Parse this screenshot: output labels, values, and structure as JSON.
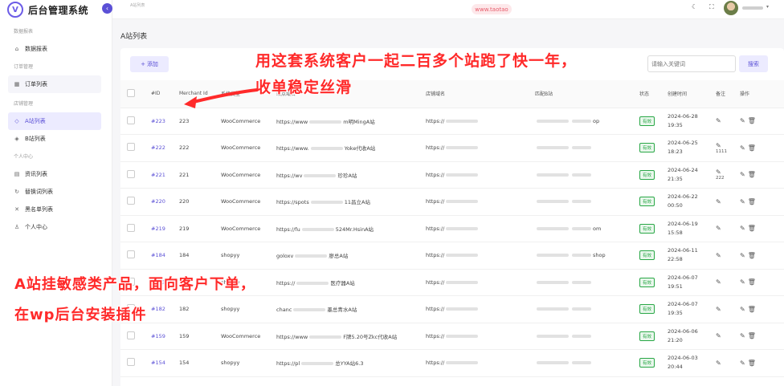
{
  "brand": {
    "title": "后台管理系统",
    "logo": "V",
    "collapse_icon": "‹"
  },
  "topbar": {
    "breadcrumb": "A站列表",
    "watermark": "www.taotao"
  },
  "sidebar": {
    "groups": [
      {
        "label": "数据报表",
        "items": [
          {
            "label": "数据报表",
            "icon": "chart-icon"
          }
        ]
      },
      {
        "label": "订单管理",
        "items": [
          {
            "label": "订单列表",
            "icon": "list-icon"
          }
        ]
      },
      {
        "label": "店铺管理",
        "items": [
          {
            "label": "A站列表",
            "icon": "store-icon"
          },
          {
            "label": "B站列表",
            "icon": "store-icon"
          }
        ]
      },
      {
        "label": "个人中心",
        "items": [
          {
            "label": "资讯列表",
            "icon": "news-icon"
          },
          {
            "label": "替换词列表",
            "icon": "replace-icon"
          },
          {
            "label": "黑名单列表",
            "icon": "blacklist-icon"
          },
          {
            "label": "个人中心",
            "icon": "user-icon"
          }
        ]
      }
    ]
  },
  "main": {
    "page_title": "A站列表",
    "add_label": "添加",
    "search_placeholder": "请输入关键词",
    "search_label": "搜索"
  },
  "table": {
    "headers": [
      "#ID",
      "Merchant Id",
      "系统类型",
      "站点域名",
      "店铺域名",
      "匹配B站",
      "状态",
      "创建时间",
      "备注",
      "操作"
    ],
    "rows": [
      {
        "id": "#223",
        "merchant": "223",
        "system": "WooCommerce",
        "site": "https://www",
        "site_tail": "m明MingA站",
        "shop": "https://",
        "b": "op",
        "status": "有效",
        "date": "2024-06-28",
        "time": "19:35",
        "note": ""
      },
      {
        "id": "#222",
        "merchant": "222",
        "system": "WooCommerce",
        "site": "https://www.",
        "site_tail": "Yoke代收A站",
        "shop": "https://",
        "b": "",
        "status": "有效",
        "date": "2024-06-25",
        "time": "18:23",
        "note": "1111"
      },
      {
        "id": "#221",
        "merchant": "221",
        "system": "WooCommerce",
        "site": "https://wv",
        "site_tail": "珍珍A站",
        "shop": "https://",
        "b": "",
        "status": "有效",
        "date": "2024-06-24",
        "time": "21:35",
        "note": "222"
      },
      {
        "id": "#220",
        "merchant": "220",
        "system": "WooCommerce",
        "site": "https://spots",
        "site_tail": "11昌立A站",
        "shop": "https://",
        "b": "",
        "status": "有效",
        "date": "2024-06-22",
        "time": "00:50",
        "note": ""
      },
      {
        "id": "#219",
        "merchant": "219",
        "system": "WooCommerce",
        "site": "https://fu",
        "site_tail": "524Mr.HsinA站",
        "shop": "https://",
        "b": "om",
        "status": "有效",
        "date": "2024-06-19",
        "time": "15:58",
        "note": ""
      },
      {
        "id": "#184",
        "merchant": "184",
        "system": "shopyy",
        "site": "goloxv",
        "site_tail": "廖总A站",
        "shop": "https://",
        "b": "shop",
        "status": "有效",
        "date": "2024-06-11",
        "time": "22:58",
        "note": ""
      },
      {
        "id": "#183",
        "merchant": "183",
        "system": "shopyy",
        "site": "https://",
        "site_tail": "医疗器A站",
        "shop": "https://",
        "b": "",
        "status": "有效",
        "date": "2024-06-07",
        "time": "19:51",
        "note": ""
      },
      {
        "id": "#182",
        "merchant": "182",
        "system": "shopyy",
        "site": "chanc",
        "site_tail": "墨总青水A站",
        "shop": "https://",
        "b": "",
        "status": "有效",
        "date": "2024-06-07",
        "time": "19:35",
        "note": ""
      },
      {
        "id": "#159",
        "merchant": "159",
        "system": "WooCommerce",
        "site": "https://www",
        "site_tail": "F牌5.20号Zkc代收A站",
        "shop": "https://",
        "b": "",
        "status": "有效",
        "date": "2024-06-06",
        "time": "21:20",
        "note": ""
      },
      {
        "id": "#154",
        "merchant": "154",
        "system": "shopyy",
        "site": "https://pl",
        "site_tail": "总YYA站6.3",
        "shop": "https://",
        "b": "",
        "status": "有效",
        "date": "2024-06-03",
        "time": "20:44",
        "note": ""
      }
    ]
  },
  "annotations": {
    "top_line1": "用这套系统客户一起二百多个站跑了快一年，",
    "top_line2": "收单稳定丝滑",
    "bottom_line1": "A站挂敏感类产品，面向客户下单，",
    "bottom_line2": "在wp后台安装插件"
  },
  "colors": {
    "accent": "#5b50d6",
    "annotation": "#ff2a2a",
    "status": "#28a745"
  }
}
